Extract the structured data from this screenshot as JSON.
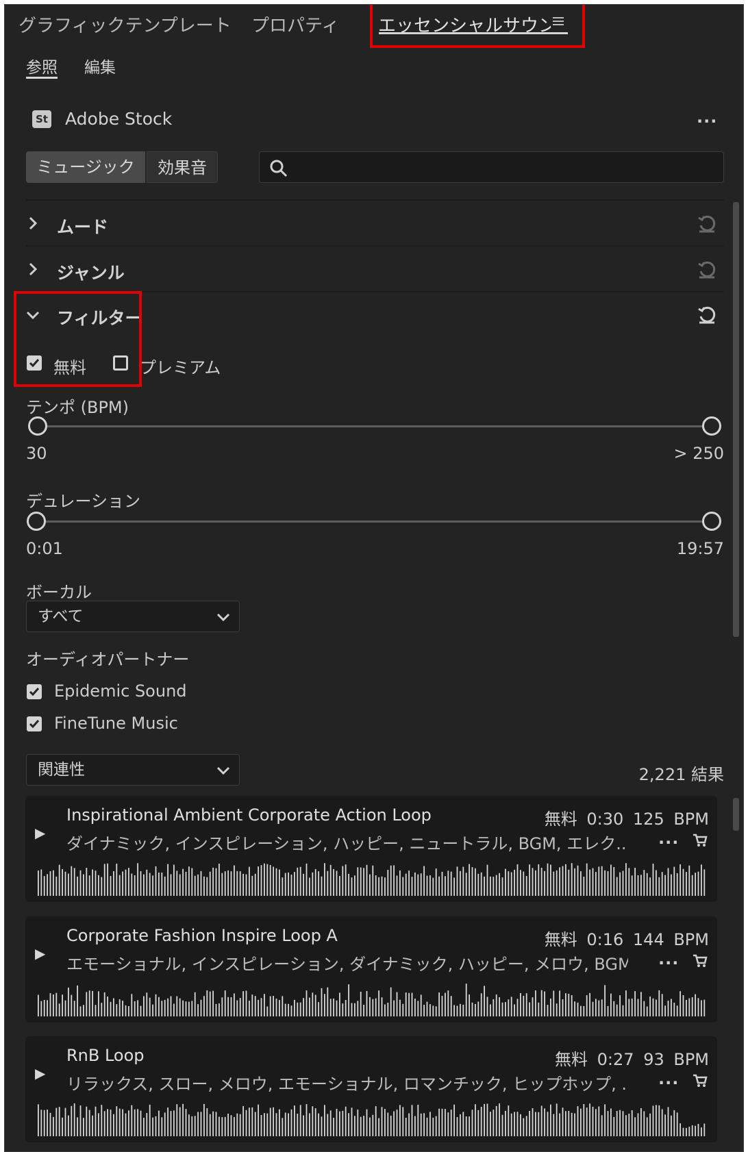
{
  "tabs": [
    {
      "label": "グラフィックテンプレート"
    },
    {
      "label": "プロパティ"
    },
    {
      "label": "エッセンシャルサウント"
    }
  ],
  "subtabs": [
    {
      "label": "参照"
    },
    {
      "label": "編集"
    }
  ],
  "stock": {
    "badge": "St",
    "title": "Adobe Stock",
    "menu": "..."
  },
  "type_toggle": {
    "music": "ミュージック",
    "sfx": "効果音"
  },
  "search": {
    "placeholder": "",
    "icon": "search-icon"
  },
  "sections": {
    "mood": "ムード",
    "genre": "ジャンル",
    "filter": "フィルター"
  },
  "filter": {
    "free": {
      "label": "無料",
      "checked": true
    },
    "premium": {
      "label": "プレミアム",
      "checked": false
    }
  },
  "tempo": {
    "label": "テンポ (BPM)",
    "min": "30",
    "max": "> 250"
  },
  "duration": {
    "label": "デュレーション",
    "min": "0:01",
    "max": "19:57"
  },
  "vocal": {
    "label": "ボーカル",
    "value": "すべて"
  },
  "partners": {
    "label": "オーディオパートナー",
    "items": [
      {
        "label": "Epidemic Sound",
        "checked": true
      },
      {
        "label": "FineTune Music",
        "checked": true
      }
    ]
  },
  "sort": {
    "value": "関連性",
    "results": "2,221 結果"
  },
  "tracks": [
    {
      "title": "Inspirational Ambient Corporate Action Loop",
      "license": "無料",
      "duration": "0:30",
      "bpm": "125 BPM",
      "tags": "ダイナミック, インスピレーション, ハッピー, ニュートラル, BGM, エレク..."
    },
    {
      "title": "Corporate Fashion Inspire Loop A",
      "license": "無料",
      "duration": "0:16",
      "bpm": "144 BPM",
      "tags": "エモーショナル, インスピレーション, ダイナミック, ハッピー, メロウ, BGM..."
    },
    {
      "title": "RnB Loop",
      "license": "無料",
      "duration": "0:27",
      "bpm": "93 BPM",
      "tags": "リラックス, スロー, メロウ, エモーショナル, ロマンチック, ヒップホップ, ..."
    }
  ],
  "colors": {
    "highlight": "#e00000",
    "panel_bg": "#232323",
    "track_bg": "#1a1a1a"
  }
}
